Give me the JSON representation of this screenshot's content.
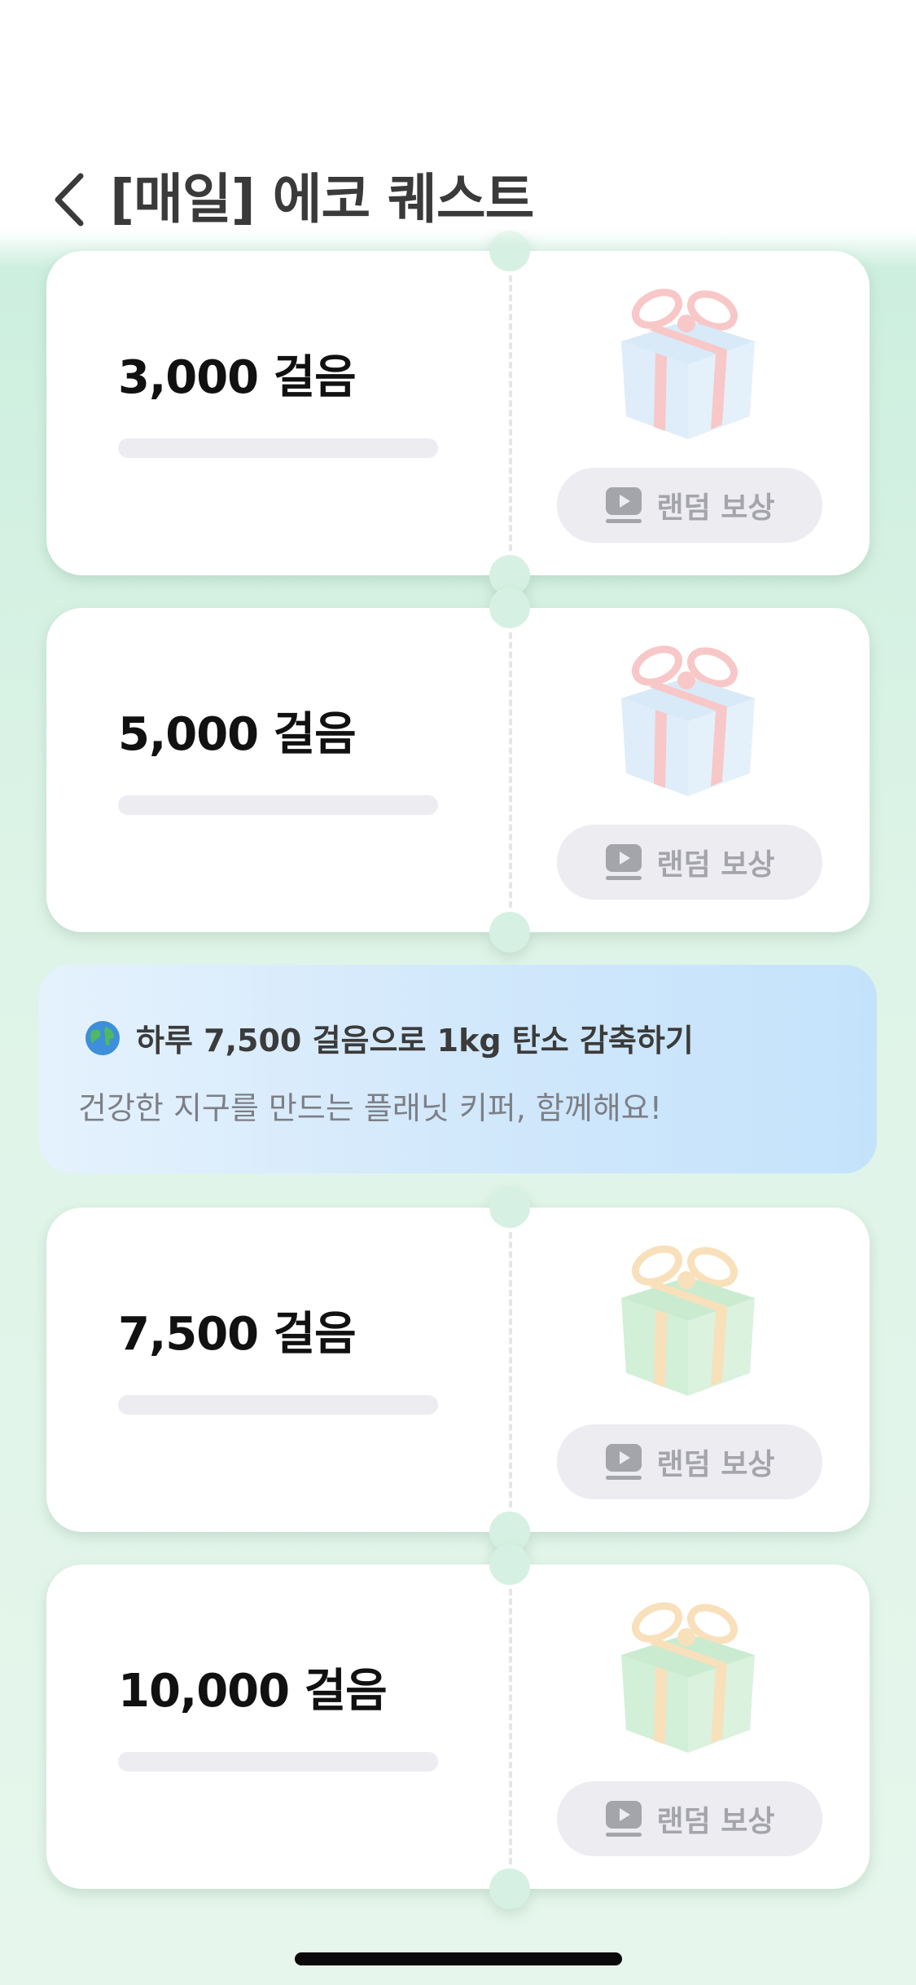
{
  "header": {
    "title": "[매일] 에코 퀘스트",
    "back_icon": "chevron-left-icon"
  },
  "quests": [
    {
      "steps_label": "3,000 걸음",
      "progress": 0,
      "reward_label": "랜덤 보상",
      "reward_icon": "play-video-icon",
      "gift_icon": "gift-box-icon",
      "gift_color": "#b9d8f2",
      "ribbon_color": "#f39a9a"
    },
    {
      "steps_label": "5,000 걸음",
      "progress": 0,
      "reward_label": "랜덤 보상",
      "reward_icon": "play-video-icon",
      "gift_icon": "gift-box-icon",
      "gift_color": "#b9d8f2",
      "ribbon_color": "#f39a9a"
    },
    {
      "steps_label": "7,500 걸음",
      "progress": 0,
      "reward_label": "랜덤 보상",
      "reward_icon": "play-video-icon",
      "gift_icon": "gift-box-icon",
      "gift_color": "#9fdcaa",
      "ribbon_color": "#f3c785"
    },
    {
      "steps_label": "10,000 걸음",
      "progress": 0,
      "reward_label": "랜덤 보상",
      "reward_icon": "play-video-icon",
      "gift_icon": "gift-box-icon",
      "gift_color": "#9fdcaa",
      "ribbon_color": "#f3c785"
    }
  ],
  "banner": {
    "icon": "globe-icon",
    "title": "하루 7,500 걸음으로 1kg 탄소 감축하기",
    "subtitle": "건강한 지구를 만드는 플래닛 키퍼, 함께해요!"
  },
  "colors": {
    "accent_green": "#cdefdf",
    "banner_blue": "#c4e3fb",
    "button_gray": "#ececf1"
  }
}
